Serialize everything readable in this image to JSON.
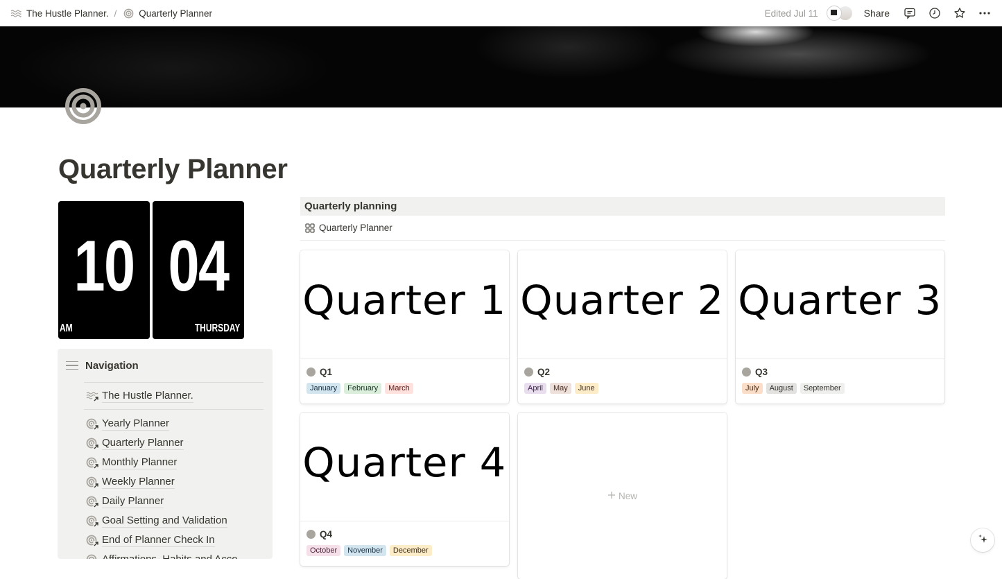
{
  "topbar": {
    "breadcrumbs": [
      {
        "label": "The Hustle Planner.",
        "icon": "waves-icon"
      },
      {
        "label": "Quarterly Planner",
        "icon": "target-icon"
      }
    ],
    "separator": "/",
    "edited": "Edited Jul 11",
    "share_label": "Share",
    "actions": [
      "comment-icon",
      "history-icon",
      "star-icon",
      "more-icon"
    ]
  },
  "page": {
    "title": "Quarterly Planner",
    "icon": "target-icon"
  },
  "clock": {
    "hour": "10",
    "minute": "04",
    "period": "AM",
    "weekday": "THURSDAY"
  },
  "navigation": {
    "title": "Navigation",
    "home": "The Hustle Planner.",
    "items": [
      "Yearly Planner",
      "Quarterly Planner",
      "Monthly Planner",
      "Weekly Planner",
      "Daily Planner",
      "Goal Setting and Validation",
      "End of Planner Check In",
      "Affirmations, Habits and Acco..."
    ]
  },
  "database": {
    "heading": "Quarterly planning",
    "view_label": "Quarterly Planner",
    "new_label": "New",
    "cards": [
      {
        "cover_text": "Quarter 1",
        "name": "Q1",
        "tags": [
          {
            "label": "January",
            "bg": "#d3e5ef",
            "fg": "#183347"
          },
          {
            "label": "February",
            "bg": "#dbeddb",
            "fg": "#1c3829"
          },
          {
            "label": "March",
            "bg": "#ffe2dd",
            "fg": "#5d1715"
          }
        ]
      },
      {
        "cover_text": "Quarter 2",
        "name": "Q2",
        "tags": [
          {
            "label": "April",
            "bg": "#e8deee",
            "fg": "#412454"
          },
          {
            "label": "May",
            "bg": "#eee0da",
            "fg": "#442a1e"
          },
          {
            "label": "June",
            "bg": "#fdecc8",
            "fg": "#402c1b"
          }
        ]
      },
      {
        "cover_text": "Quarter 3",
        "name": "Q3",
        "tags": [
          {
            "label": "July",
            "bg": "#fadec9",
            "fg": "#49290e"
          },
          {
            "label": "August",
            "bg": "#e3e2e0",
            "fg": "#32302c"
          },
          {
            "label": "September",
            "bg": "#efefed",
            "fg": "#32302c"
          }
        ]
      },
      {
        "cover_text": "Quarter 4",
        "name": "Q4",
        "tags": [
          {
            "label": "October",
            "bg": "#f5e0e9",
            "fg": "#4c2337"
          },
          {
            "label": "November",
            "bg": "#d3e5ef",
            "fg": "#183347"
          },
          {
            "label": "December",
            "bg": "#fdecc8",
            "fg": "#402c1b"
          }
        ]
      }
    ]
  }
}
